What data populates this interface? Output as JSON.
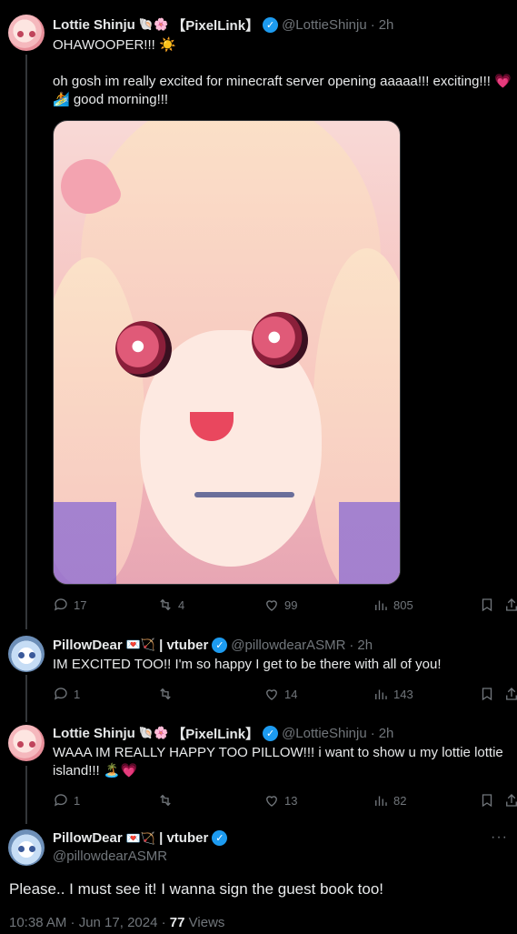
{
  "tweet1": {
    "name": "Lottie Shinju",
    "name_emoji": "🐚🌸",
    "tag": "【PixelLink】",
    "handle": "@LottieShinju",
    "dot": "·",
    "time": "2h",
    "line1": "OHAWOOPER!!! ☀️",
    "line2": "oh gosh im really excited for minecraft server opening aaaaa!!! exciting!!! 💗",
    "line3": "🏄 good morning!!!",
    "replies": "17",
    "reposts": "4",
    "likes": "99",
    "views": "805"
  },
  "tweet2": {
    "name": "PillowDear",
    "name_emoji": "💌🏹",
    "tag": "| vtuber",
    "handle": "@pillowdearASMR",
    "dot": "·",
    "time": "2h",
    "text": "IM EXCITED TOO!! I'm so happy I get to be there with all of you!",
    "replies": "1",
    "reposts": "",
    "likes": "14",
    "views": "143"
  },
  "tweet3": {
    "name": "Lottie Shinju",
    "name_emoji": "🐚🌸",
    "tag": "【PixelLink】",
    "handle": "@LottieShinju",
    "dot": "·",
    "time": "2h",
    "line1": "WAAA IM REALLY HAPPY TOO PILLOW!!! i want to show u my lottie lottie",
    "line2": "island!!! 🏝️💗",
    "replies": "1",
    "reposts": "",
    "likes": "13",
    "views": "82"
  },
  "focal": {
    "name": "PillowDear",
    "name_emoji": "💌🏹",
    "tag": "| vtuber",
    "handle": "@pillowdearASMR",
    "text": "Please.. I must see it! I wanna sign the guest book too!",
    "timestamp": "10:38 AM · Jun 17, 2024 ·",
    "views_count": "77",
    "views_label": "Views"
  },
  "colors": {
    "accent": "#1d9bf0",
    "muted": "#71767b",
    "text": "#e7e9ea",
    "background": "#000000"
  }
}
